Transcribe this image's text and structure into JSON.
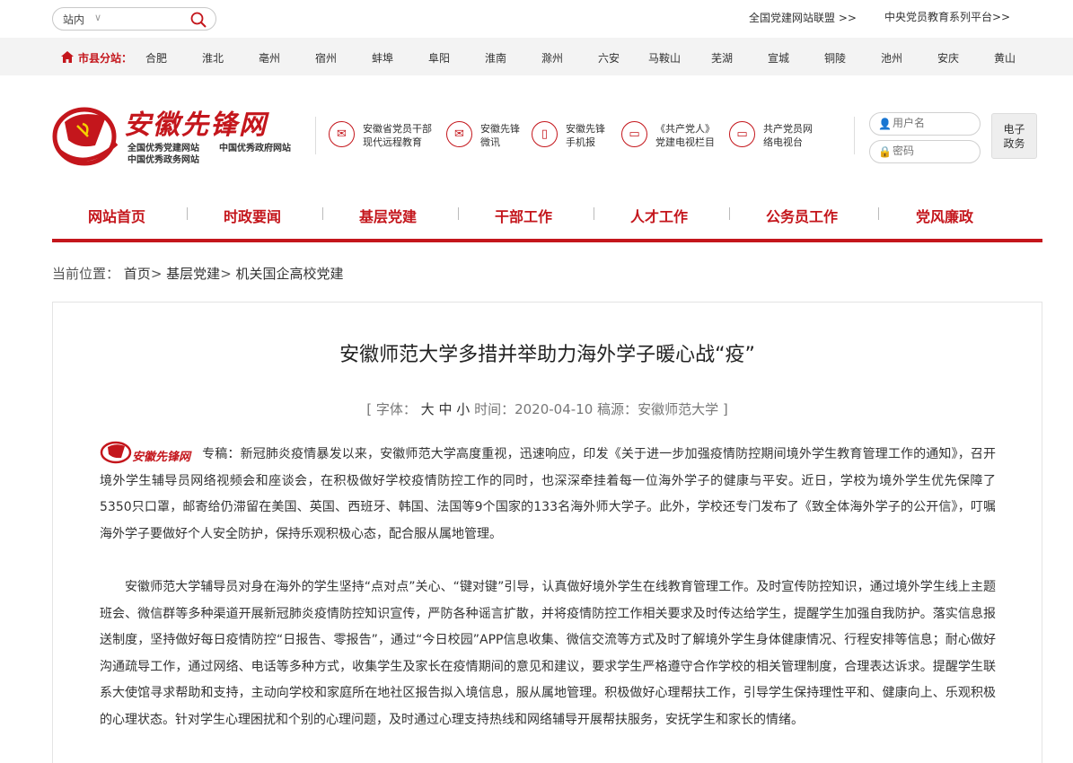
{
  "top": {
    "search_scope": "站内",
    "search_placeholder": "",
    "link_alliance": "全国党建网站联盟 >>",
    "link_education": "中央党员教育系列平台>>"
  },
  "city_bar": {
    "label": "市县分站：",
    "cities": [
      "合肥",
      "淮北",
      "亳州",
      "宿州",
      "蚌埠",
      "阜阳",
      "淮南",
      "滁州",
      "六安",
      "马鞍山",
      "芜湖",
      "宣城",
      "铜陵",
      "池州",
      "安庆",
      "黄山"
    ]
  },
  "header": {
    "logo_title": "安徽先锋网",
    "logo_sub_1": "全国优秀党建网站",
    "logo_sub_2": "中国优秀政府网站",
    "logo_sub_3": "中国优秀政务网站",
    "quick_links": [
      {
        "icon": "mail-icon",
        "line1": "安徽省党员干部",
        "line2": "现代远程教育"
      },
      {
        "icon": "wechat-icon",
        "line1": "安徽先锋",
        "line2": "微讯"
      },
      {
        "icon": "phone-icon",
        "line1": "安徽先锋",
        "line2": "手机报"
      },
      {
        "icon": "tv-icon",
        "line1": "《共产党人》",
        "line2": "党建电视栏目"
      },
      {
        "icon": "tv-icon",
        "line1": "共产党员网",
        "line2": "络电视台"
      }
    ],
    "username_placeholder": "用户名",
    "password_placeholder": "密码",
    "egov_line1": "电子",
    "egov_line2": "政务"
  },
  "nav": {
    "items": [
      "网站首页",
      "时政要闻",
      "基层党建",
      "干部工作",
      "人才工作",
      "公务员工作",
      "党风廉政"
    ]
  },
  "breadcrumb": {
    "label": "当前位置：",
    "home": "首页",
    "level1": "基层党建",
    "level2": "机关国企高校党建",
    "sep": ">"
  },
  "article": {
    "title": "安徽师范大学多措并举助力海外学子暖心战“疫”",
    "meta_open": "[ 字体：",
    "size_large": "大",
    "size_medium": "中",
    "size_small": "小",
    "time_label": "时间：",
    "time": "2020-04-10",
    "source_label": "稿源：",
    "source": "安徽师范大学",
    "meta_close": "]",
    "inline_logo_text": "安徽先锋网",
    "para1": "专稿：新冠肺炎疫情暴发以来，安徽师范大学高度重视，迅速响应，印发《关于进一步加强疫情防控期间境外学生教育管理工作的通知》，召开境外学生辅导员网络视频会和座谈会，在积极做好学校疫情防控工作的同时，也深深牵挂着每一位海外学子的健康与平安。近日，学校为境外学生优先保障了5350只口罩，邮寄给仍滞留在美国、英国、西班牙、韩国、法国等9个国家的133名海外师大学子。此外，学校还专门发布了《致全体海外学子的公开信》，叮嘱海外学子要做好个人安全防护，保持乐观积极心态，配合服从属地管理。",
    "para2": "安徽师范大学辅导员对身在海外的学生坚持“点对点”关心、“键对键”引导，认真做好境外学生在线教育管理工作。及时宣传防控知识，通过境外学生线上主题班会、微信群等多种渠道开展新冠肺炎疫情防控知识宣传，严防各种谣言扩散，并将疫情防控工作相关要求及时传达给学生，提醒学生加强自我防护。落实信息报送制度，坚持做好每日疫情防控“日报告、零报告”，通过“今日校园”APP信息收集、微信交流等方式及时了解境外学生身体健康情况、行程安排等信息；耐心做好沟通疏导工作，通过网络、电话等多种方式，收集学生及家长在疫情期间的意见和建议，要求学生严格遵守合作学校的相关管理制度，合理表达诉求。提醒学生联系大使馆寻求帮助和支持，主动向学校和家庭所在地社区报告拟入境信息，服从属地管理。积极做好心理帮扶工作，引导学生保持理性平和、健康向上、乐观积极的心理状态。针对学生心理困扰和个别的心理问题，及时通过心理支持热线和网络辅导开展帮扶服务，安抚学生和家长的情绪。"
  },
  "colors": {
    "brand_red": "#c4161c",
    "city_bar_bg": "#f3f3f3"
  }
}
